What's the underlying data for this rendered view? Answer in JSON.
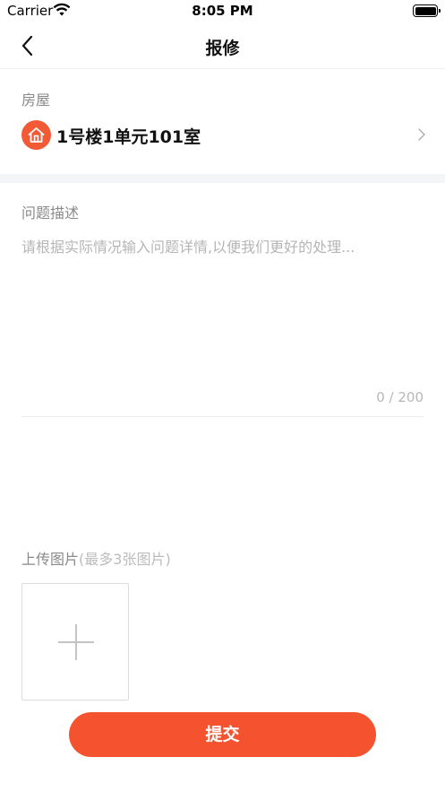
{
  "status_bar": {
    "carrier": "Carrier",
    "time": "8:05 PM",
    "wifi_icon": "wifi-icon",
    "battery_icon": "battery-icon"
  },
  "nav": {
    "title": "报修",
    "back_icon": "chevron-left-icon"
  },
  "house": {
    "label": "房屋",
    "name": "1号楼1单元101室",
    "icon": "house-icon",
    "chevron_icon": "chevron-right-icon"
  },
  "description": {
    "label": "问题描述",
    "value": "",
    "placeholder": "请根据实际情况输入问题详情,以便我们更好的处理...",
    "char_count": "0 / 200"
  },
  "upload": {
    "label": "上传图片",
    "hint": "(最多3张图片)",
    "add_icon": "plus-icon"
  },
  "submit": {
    "label": "提交"
  },
  "colors": {
    "accent": "#f5522f",
    "icon_bg": "#f25a35",
    "label_gray": "#8a8a8a",
    "placeholder_gray": "#b5b5b5",
    "section_band": "#f4f5f7"
  }
}
